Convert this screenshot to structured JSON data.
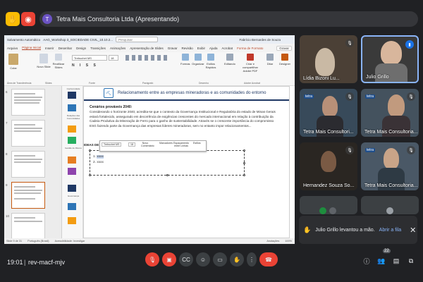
{
  "meet": {
    "presenter_initial": "T",
    "presenting_label": "Tetra Mais Consultoria Ltda (Apresentando)",
    "clock": "19:01",
    "meeting_code": "rev-macf-mjv",
    "participant_count": "22",
    "colors": {
      "accent": "#8ab4f8",
      "danger": "#ea4335",
      "bg": "#202124"
    }
  },
  "ppt": {
    "autosave": "Salvamento Automático",
    "filename": "AAG_Workshop 3_SOCIEDADE CIVIL_10.10.2...",
    "search_placeholder": "Pesquisar",
    "user": "Fabrício Bernardes de Souza",
    "tabs": [
      "Arquivo",
      "Página Inicial",
      "Inserir",
      "Desenhar",
      "Design",
      "Transições",
      "Animações",
      "Apresentação de Slides",
      "Gravar",
      "Revisão",
      "Exibir",
      "Ajuda",
      "Acrobat",
      "Forma de Formato"
    ],
    "active_tab": "Página Inicial",
    "record_btn": "Gravar",
    "font_name": "Trebuchet MS",
    "font_size": "18",
    "ribbon_labels": {
      "paste": "Colar",
      "new_slide": "Novo Slide",
      "reuse": "Reutilizar Slides",
      "clipboard": "Área de Transferência",
      "slides": "Slides",
      "font": "Fonte",
      "paragraph": "Parágrafo",
      "shapes": "Formas",
      "arrange": "Organizar",
      "quick_styles": "Estilos Rápidos",
      "drawing": "Desenho",
      "editing": "Editando",
      "create_pdf": "Criar e compartilhar Adobe PDF",
      "adobe": "Adobe Acrobat",
      "voice": "Ditar",
      "designer": "Designer"
    },
    "thumb_numbers": [
      "6",
      "7",
      "8",
      "9",
      "10"
    ],
    "section_labels": [
      "Conformidade",
      "Relações das Comunidades",
      "Gestão de Riscos",
      "Governança"
    ],
    "slide": {
      "title": "Relacionamento entre as empresas mineradoras e as comunidades   do entorno",
      "subtitle": "Cenários prováveis 2040:",
      "body": "Considerando o horizonte 2040, acredita-se que o contexto da Governança Institucional e Regulatória do estado de Minas Gerais estará fortalecido, assegurado em decorrência de exigências crescentes do mercado internacional em relação à contribuição da Cadeia Produtiva da Mineração de Ferro para o ganho de sustentabilidade. Através se o crescente importância do compromisso ESG fazendo parte da Governança das empresas líderes mineradoras, sem no entanto impor relacionamentos...",
      "ideas_label": "IDEAS DE",
      "list_items": [
        "1.",
        "2."
      ],
      "placeholder": "xxxx",
      "mini_toolbar": {
        "font": "Trebuchet MS",
        "size": "18",
        "new_comment": "Novo Comentário",
        "bullets": "Marcadores",
        "spacing": "Espaçamento entre Linhas",
        "styles": "Estilos"
      }
    },
    "status": {
      "slide": "Slide 9 de 31",
      "language": "Português (Brasil)",
      "accessibility": "Acessibilidade: Investigar",
      "notes": "Anotações",
      "zoom": "100%"
    }
  },
  "participants": [
    {
      "name": "Lídia Bizoni Lu..."
    },
    {
      "name": "Julio Grillo"
    },
    {
      "name": "Tetra Mais Consultori..."
    },
    {
      "name": "Tetra Mais Consultoria..."
    },
    {
      "name": "Hernandez Souza So..."
    },
    {
      "name": "Tetra Mais Consultoria..."
    }
  ],
  "notification": {
    "text": "Julio Grillo levantou a mão.",
    "action": "Abrir a fila"
  }
}
